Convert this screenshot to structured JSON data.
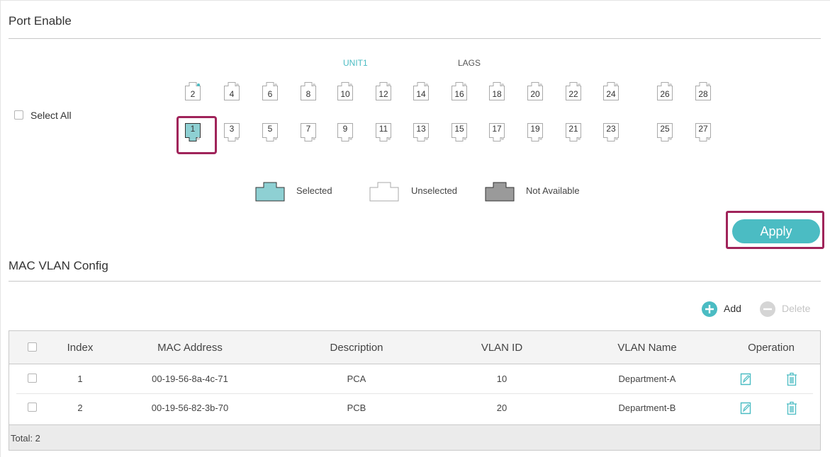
{
  "port_enable": {
    "title": "Port Enable",
    "select_all_label": "Select All",
    "unit_tab": "UNIT1",
    "lags_tab": "LAGS",
    "ports_top": [
      "2",
      "4",
      "6",
      "8",
      "10",
      "12",
      "14",
      "16",
      "18",
      "20",
      "22",
      "24",
      "26",
      "28"
    ],
    "ports_bottom": [
      "1",
      "3",
      "5",
      "7",
      "9",
      "11",
      "13",
      "15",
      "17",
      "19",
      "21",
      "23",
      "25",
      "27"
    ],
    "selected_port": "1",
    "legend": {
      "selected": "Selected",
      "unselected": "Unselected",
      "not_available": "Not Available"
    },
    "apply_label": "Apply"
  },
  "mac_vlan": {
    "title": "MAC VLAN Config",
    "add_label": "Add",
    "delete_label": "Delete",
    "columns": [
      "Index",
      "MAC Address",
      "Description",
      "VLAN ID",
      "VLAN Name",
      "Operation"
    ],
    "rows": [
      {
        "index": "1",
        "mac": "00-19-56-8a-4c-71",
        "description": "PCA",
        "vlan_id": "10",
        "vlan_name": "Department-A"
      },
      {
        "index": "2",
        "mac": "00-19-56-82-3b-70",
        "description": "PCB",
        "vlan_id": "20",
        "vlan_name": "Department-B"
      }
    ],
    "total": "Total: 2"
  },
  "colors": {
    "accent": "#4bbcc3",
    "highlight": "#a0245a",
    "unavailable": "#9a9a9a"
  },
  "icons": [
    "edit-icon",
    "trash-icon",
    "plus-circle-icon",
    "minus-circle-icon",
    "port-icon"
  ]
}
